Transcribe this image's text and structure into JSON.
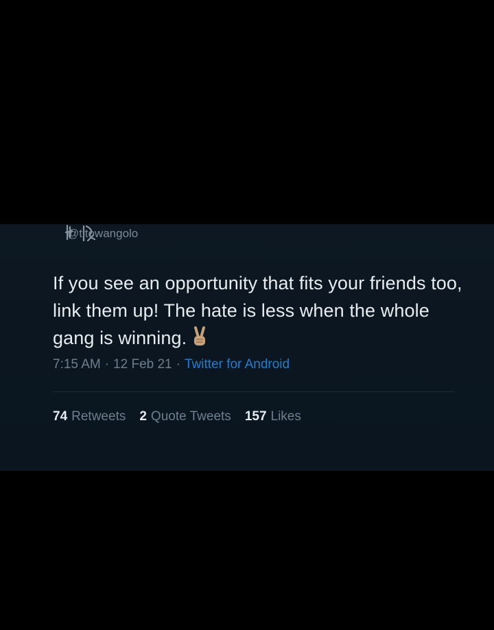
{
  "tweet": {
    "handle": "@titowangolo",
    "text": "If you see an opportunity that fits your friends too, link them up! The hate is less when the whole gang is winning.",
    "emoji_icon": "victory-hand-emoji",
    "time": "7:15 AM",
    "separator": "·",
    "date": "12 Feb 21",
    "source": "Twitter for Android",
    "source_color": "#1d7fd4"
  },
  "stats": [
    {
      "count": "74",
      "label": "Retweets"
    },
    {
      "count": "2",
      "label": "Quote Tweets"
    },
    {
      "count": "157",
      "label": "Likes"
    }
  ],
  "colors": {
    "background": "#000000",
    "card": "#0b1620",
    "text": "#e8ecef",
    "muted": "#6e7f8f"
  }
}
